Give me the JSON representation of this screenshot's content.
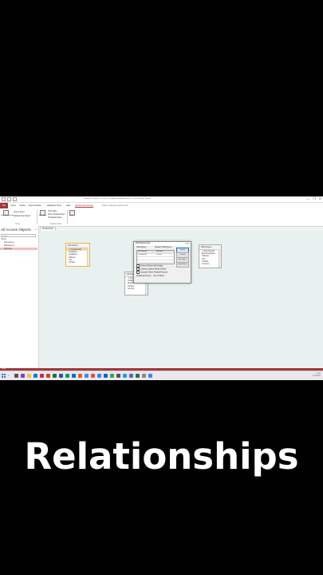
{
  "window": {
    "title": "Database4 : Database- C:\\Users\\...\\Database4.accdb (Access 2007 - 2016 file format) - Access",
    "controls": [
      "—",
      "❐",
      "✕"
    ]
  },
  "ribbon": {
    "tabs": [
      "File",
      "Home",
      "Create",
      "External Data",
      "Database Tools",
      "Help",
      "Relationship Design"
    ],
    "active_tab": "Relationship Design",
    "tell_me": "Tell me what you want to do",
    "tools": {
      "edit_relationships": "Edit Relationships",
      "clear_layout": "Clear Layout",
      "relationship_report": "Relationship Report",
      "group_tools": "Tools"
    },
    "relationships": {
      "add_tables": "Add Tables",
      "hide_table": "Hide Table",
      "direct_relationships": "Direct Relationships",
      "all_relationships": "All Relationships",
      "group_relationships": "Relationships"
    },
    "close": "Close"
  },
  "nav": {
    "header": "All Access Objects",
    "search_placeholder": "Search...",
    "group": "Tables",
    "items": [
      {
        "label": "tblCustomer"
      },
      {
        "label": "tblEmployee"
      },
      {
        "label": "tblInvoice"
      }
    ]
  },
  "document_tab": "Relationships",
  "tables": [
    {
      "name": "tblCustomer",
      "fields": [
        "CustomerID",
        "FirstName",
        "LastName",
        "Address",
        "City",
        "Contact"
      ]
    },
    {
      "name": "tblInvoice",
      "fields": [
        "InvID",
        "CustID",
        "EmpID",
        "InvDate",
        "Amount"
      ]
    },
    {
      "name": "tblEmployee",
      "fields": [
        "EmployeeID",
        "EmployeeName",
        "Address",
        "City",
        "Contact",
        "Currency"
      ]
    }
  ],
  "dialog": {
    "title": "Edit Relationships",
    "table_query_label": "Table/Query:",
    "related_label": "Related Table/Query:",
    "table_value": "tblCustomer",
    "related_value": "tblInvoice",
    "field_left": "CustomerID",
    "field_right": "CustID",
    "buttons": [
      "Create",
      "Cancel",
      "Join Type...",
      "Create New..."
    ],
    "checkboxes": [
      "Enforce Referential Integrity",
      "Cascade Update Related Fields",
      "Cascade Delete Related Records"
    ],
    "relationship_type_label": "Relationship Type:",
    "relationship_type_value": "One-To-Many"
  },
  "status": "Ready",
  "taskbar": {
    "search_icon": "search-icon",
    "time": "10:47",
    "date": "11/11/2022"
  },
  "caption": "Relationships"
}
